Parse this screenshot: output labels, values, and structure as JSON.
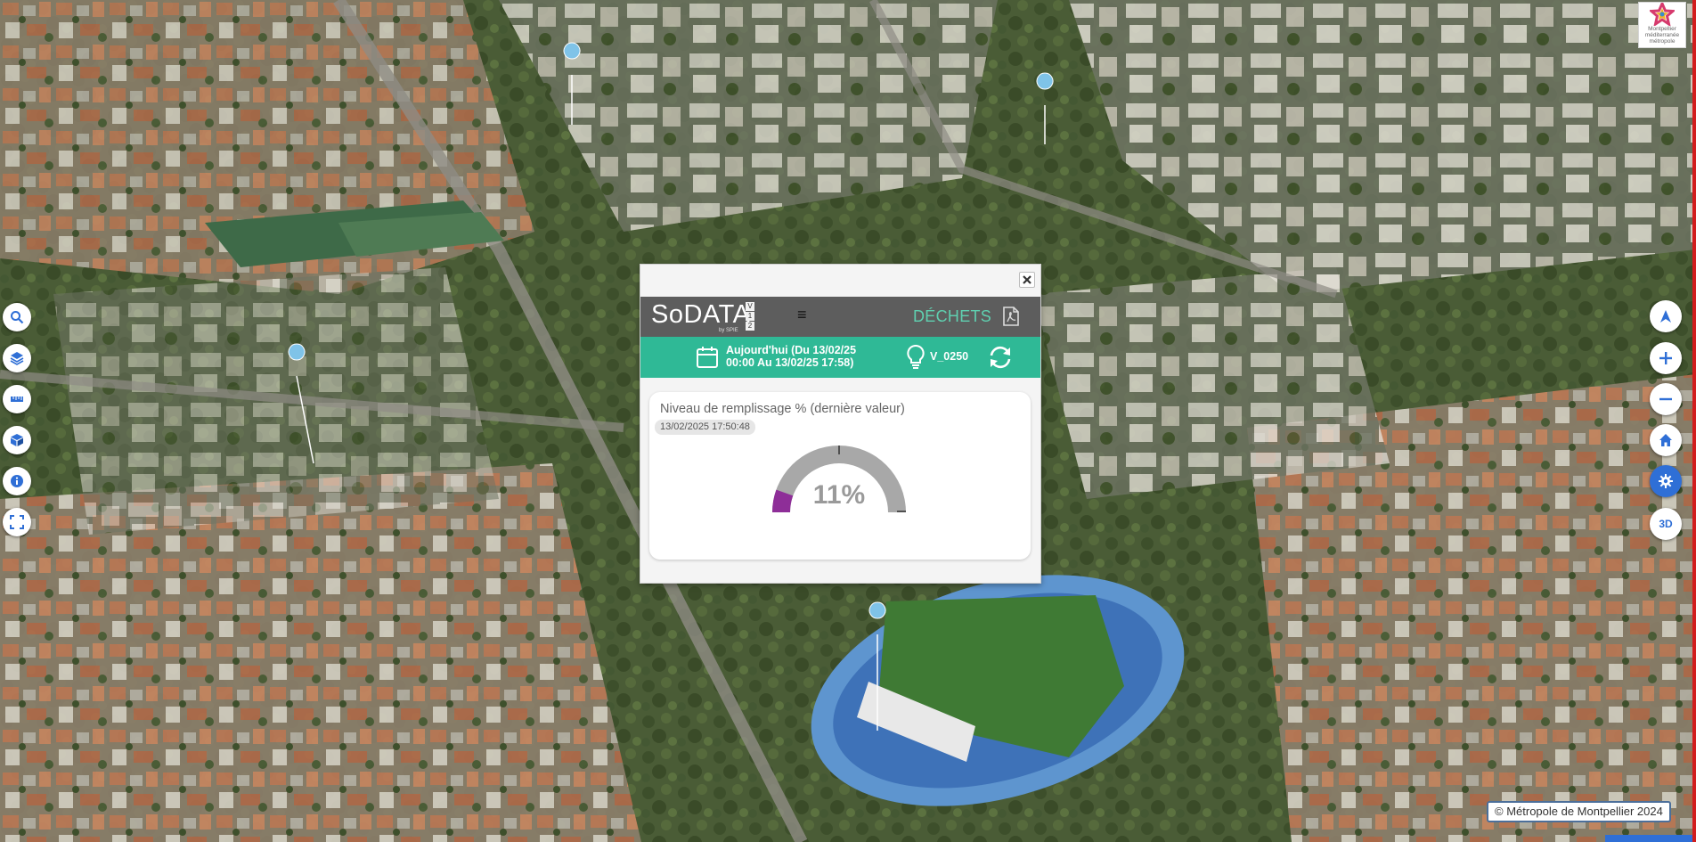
{
  "popup": {
    "brand": "SoDATA",
    "brand_sub": "by SPIE",
    "version": [
      "V",
      "1",
      "2"
    ],
    "menu_glyph": "≡",
    "module": "DÉCHETS",
    "date_range_line1": "Aujourd'hui (Du 13/02/25",
    "date_range_line2": "00:00 Au 13/02/25 17:58)",
    "sensor_id": "V_0250",
    "card": {
      "title": "Niveau de remplissage % (dernière valeur)",
      "timestamp": "13/02/2025 17:50:48",
      "value_text": "11%",
      "fill_level": 11
    }
  },
  "logo": {
    "text_line1": "Montpellier",
    "text_line2": "méditerranée",
    "text_line3": "métropole"
  },
  "attribution": "© Métropole de Montpellier 2024",
  "colors": {
    "header_bg": "#5d5d5d",
    "bar_bg": "#2fb996",
    "module_text": "#5fd0b0",
    "gauge_fill": "#8e2e98",
    "gauge_track": "#a8a8a8",
    "map_button_active": "#2f6fd6"
  },
  "toolbar_left": [
    {
      "icon": "search-icon"
    },
    {
      "icon": "layers-icon"
    },
    {
      "icon": "ruler-icon"
    },
    {
      "icon": "cube-icon"
    },
    {
      "icon": "info-icon"
    },
    {
      "icon": "fullscreen-icon"
    }
  ],
  "toolbar_right": [
    {
      "icon": "compass-icon"
    },
    {
      "icon": "zoom-in-icon"
    },
    {
      "icon": "zoom-out-icon"
    },
    {
      "icon": "home-icon"
    },
    {
      "icon": "settings-icon"
    },
    {
      "label": "3D"
    }
  ]
}
